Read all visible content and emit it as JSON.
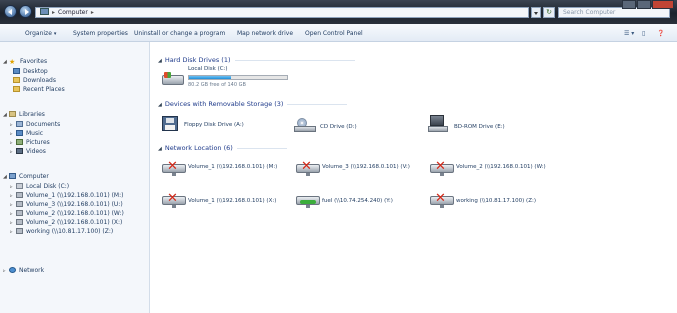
{
  "window": {
    "address": {
      "root_label": "Computer"
    },
    "search": {
      "placeholder": "Search Computer"
    }
  },
  "toolbar": {
    "organize": "Organize",
    "system_properties": "System properties",
    "uninstall": "Uninstall or change a program",
    "map_drive": "Map network drive",
    "control_panel": "Open Control Panel"
  },
  "nav": {
    "favorites": {
      "label": "Favorites",
      "items": [
        "Desktop",
        "Downloads",
        "Recent Places"
      ]
    },
    "libraries": {
      "label": "Libraries",
      "items": [
        "Documents",
        "Music",
        "Pictures",
        "Videos"
      ]
    },
    "computer": {
      "label": "Computer",
      "items": [
        "Local Disk (C:)",
        "Volume_1 (\\\\192.168.0.101) (M:)",
        "Volume_3 (\\\\192.168.0.101) (U:)",
        "Volume_2 (\\\\192.168.0.101) (W:)",
        "Volume_2 (\\\\192.168.0.101) (X:)",
        "working (\\\\10.81.17.100) (Z:)"
      ]
    },
    "network": {
      "label": "Network"
    }
  },
  "content": {
    "hard_disk": {
      "header": "Hard Disk Drives (1)",
      "drive": {
        "name": "Local Disk (C:)",
        "free_text": "80.2 GB free of 140 GB",
        "used_fraction": 0.43
      }
    },
    "removable": {
      "header": "Devices with Removable Storage (3)",
      "items": [
        "Floppy Disk Drive (A:)",
        "CD Drive (D:)",
        "BD-ROM Drive (E:)"
      ]
    },
    "network": {
      "header": "Network Location (6)",
      "items": [
        {
          "name": "Volume_1 (\\\\192.168.0.101) (M:)",
          "status": "disconnected"
        },
        {
          "name": "Volume_3 (\\\\192.168.0.101) (V:)",
          "status": "disconnected"
        },
        {
          "name": "Volume_2 (\\\\192.168.0.101) (W:)",
          "status": "disconnected"
        },
        {
          "name": "Volume_1 (\\\\192.168.0.101) (X:)",
          "status": "disconnected"
        },
        {
          "name": "fuel (\\\\10.74.254.240) (Y:)",
          "status": "connected"
        },
        {
          "name": "working (\\\\10.81.17.100) (Z:)",
          "status": "disconnected"
        }
      ]
    }
  },
  "colors": {
    "accent": "#1f8fd9",
    "group_header": "#1e3a8a",
    "error": "#d42a1a",
    "ok": "#3cae3c"
  }
}
